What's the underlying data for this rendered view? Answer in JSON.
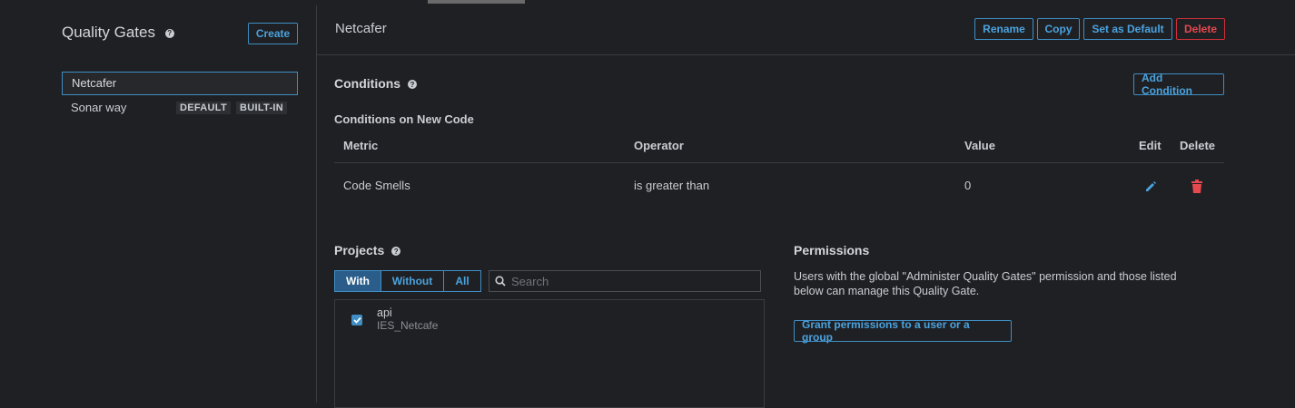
{
  "sidebar": {
    "title": "Quality Gates",
    "create_label": "Create",
    "gates": [
      {
        "name": "Netcafer",
        "selected": true,
        "badges": []
      },
      {
        "name": "Sonar way",
        "selected": false,
        "badges": [
          "DEFAULT",
          "BUILT-IN"
        ]
      }
    ]
  },
  "main": {
    "title": "Netcafer",
    "actions": {
      "rename": "Rename",
      "copy": "Copy",
      "set_default": "Set as Default",
      "delete": "Delete"
    },
    "conditions": {
      "title": "Conditions",
      "add_label": "Add Condition",
      "subtitle": "Conditions on New Code",
      "headers": {
        "metric": "Metric",
        "operator": "Operator",
        "value": "Value",
        "edit": "Edit",
        "delete": "Delete"
      },
      "rows": [
        {
          "metric": "Code Smells",
          "operator": "is greater than",
          "value": "0"
        }
      ]
    },
    "projects": {
      "title": "Projects",
      "tabs": {
        "with": "With",
        "without": "Without",
        "all": "All"
      },
      "active_tab": "With",
      "search_placeholder": "Search",
      "items": [
        {
          "name": "api",
          "key": "IES_Netcafe",
          "checked": true
        }
      ]
    },
    "permissions": {
      "title": "Permissions",
      "description": "Users with the global \"Administer Quality Gates\" permission and those listed below can manage this Quality Gate.",
      "grant_label": "Grant permissions to a user or a group"
    }
  },
  "colors": {
    "accent": "#4aa3df",
    "danger": "#e5484f",
    "background": "#1f2023"
  }
}
